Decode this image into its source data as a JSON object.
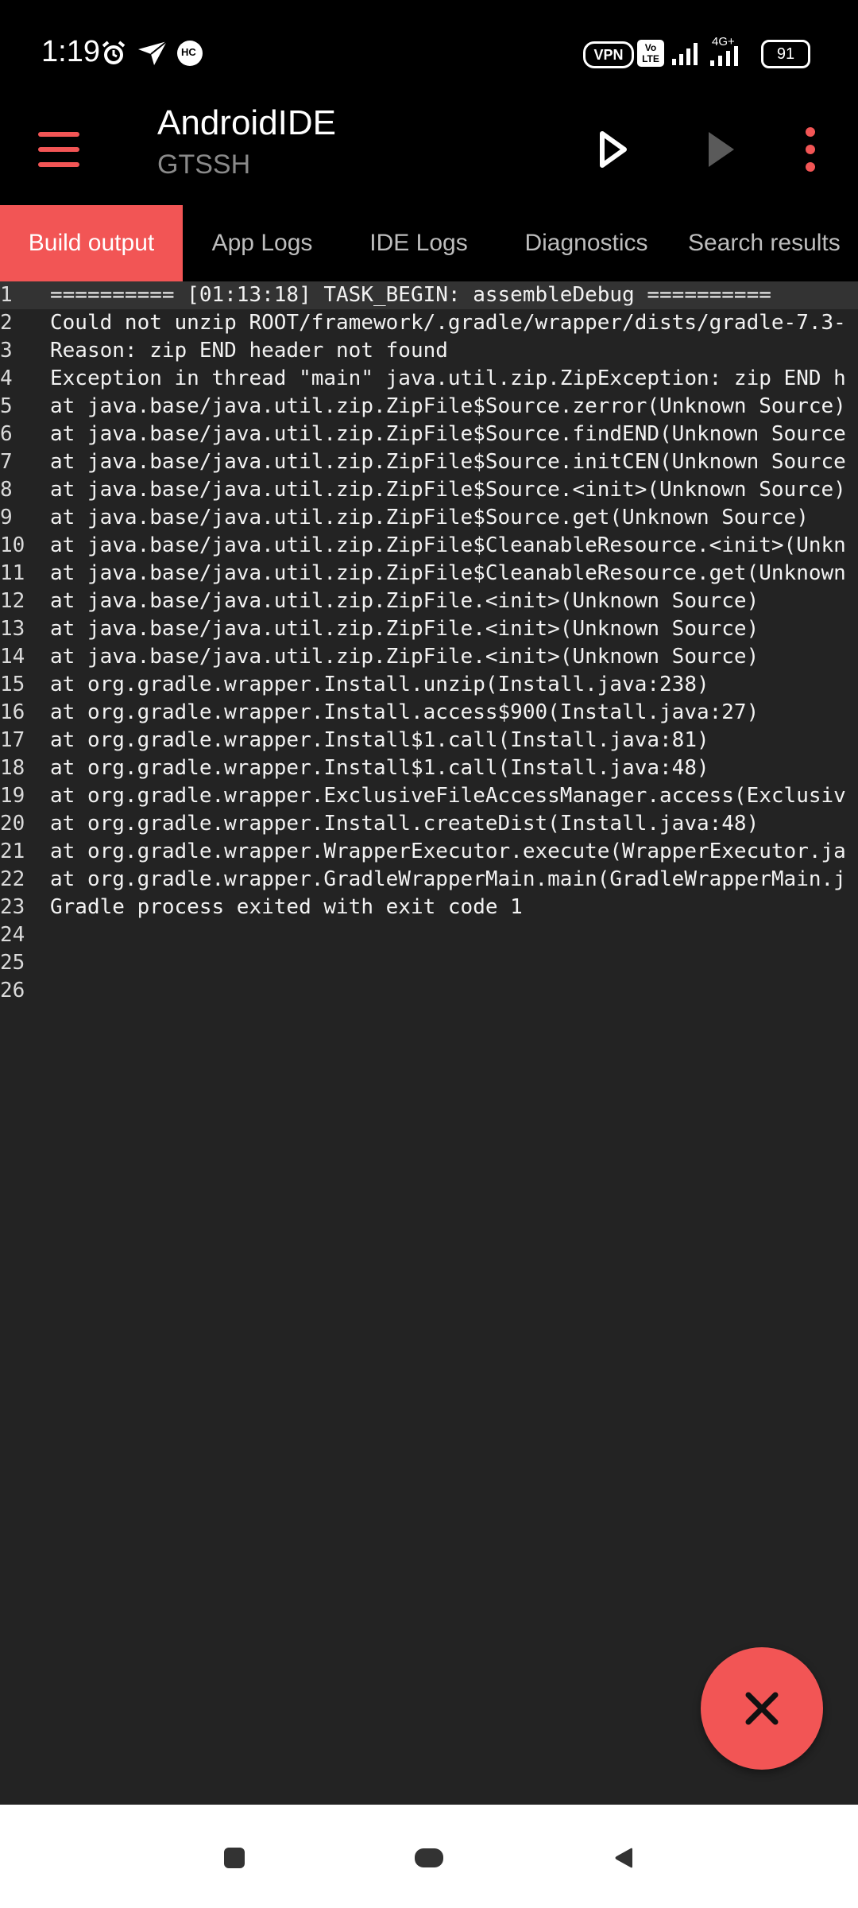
{
  "status_bar": {
    "time": "1:19",
    "vpn_label": "VPN",
    "volte_label": "Vo LTE",
    "network_label": "4G+",
    "battery_level": "91",
    "hc_label": "HC"
  },
  "toolbar": {
    "title": "AndroidIDE",
    "subtitle": "GTSSH",
    "accent_color": "#f25555"
  },
  "tabs": [
    {
      "label": "Build output",
      "active": true
    },
    {
      "label": "App Logs",
      "active": false
    },
    {
      "label": "IDE Logs",
      "active": false
    },
    {
      "label": "Diagnostics",
      "active": false
    },
    {
      "label": "Search results",
      "active": false
    }
  ],
  "log_lines": [
    {
      "n": "1",
      "text": "========== [01:13:18] TASK_BEGIN: assembleDebug =========="
    },
    {
      "n": "2",
      "text": "Could not unzip ROOT/framework/.gradle/wrapper/dists/gradle-7.3-"
    },
    {
      "n": "3",
      "text": "Reason: zip END header not found"
    },
    {
      "n": "4",
      "text": "Exception in thread \"main\" java.util.zip.ZipException: zip END h"
    },
    {
      "n": "5",
      "text": "at java.base/java.util.zip.ZipFile$Source.zerror(Unknown Source)"
    },
    {
      "n": "6",
      "text": "at java.base/java.util.zip.ZipFile$Source.findEND(Unknown Source"
    },
    {
      "n": "7",
      "text": "at java.base/java.util.zip.ZipFile$Source.initCEN(Unknown Source"
    },
    {
      "n": "8",
      "text": "at java.base/java.util.zip.ZipFile$Source.<init>(Unknown Source)"
    },
    {
      "n": "9",
      "text": "at java.base/java.util.zip.ZipFile$Source.get(Unknown Source)"
    },
    {
      "n": "10",
      "text": "at java.base/java.util.zip.ZipFile$CleanableResource.<init>(Unkn"
    },
    {
      "n": "11",
      "text": "at java.base/java.util.zip.ZipFile$CleanableResource.get(Unknown"
    },
    {
      "n": "12",
      "text": "at java.base/java.util.zip.ZipFile.<init>(Unknown Source)"
    },
    {
      "n": "13",
      "text": "at java.base/java.util.zip.ZipFile.<init>(Unknown Source)"
    },
    {
      "n": "14",
      "text": "at java.base/java.util.zip.ZipFile.<init>(Unknown Source)"
    },
    {
      "n": "15",
      "text": "at org.gradle.wrapper.Install.unzip(Install.java:238)"
    },
    {
      "n": "16",
      "text": "at org.gradle.wrapper.Install.access$900(Install.java:27)"
    },
    {
      "n": "17",
      "text": "at org.gradle.wrapper.Install$1.call(Install.java:81)"
    },
    {
      "n": "18",
      "text": "at org.gradle.wrapper.Install$1.call(Install.java:48)"
    },
    {
      "n": "19",
      "text": "at org.gradle.wrapper.ExclusiveFileAccessManager.access(Exclusiv"
    },
    {
      "n": "20",
      "text": "at org.gradle.wrapper.Install.createDist(Install.java:48)"
    },
    {
      "n": "21",
      "text": "at org.gradle.wrapper.WrapperExecutor.execute(WrapperExecutor.ja"
    },
    {
      "n": "22",
      "text": "at org.gradle.wrapper.GradleWrapperMain.main(GradleWrapperMain.j"
    },
    {
      "n": "23",
      "text": "Gradle process exited with exit code 1"
    },
    {
      "n": "24",
      "text": ""
    },
    {
      "n": "25",
      "text": ""
    },
    {
      "n": "26",
      "text": ""
    }
  ],
  "icons": {
    "menu": "hamburger-menu-icon",
    "run": "play-icon",
    "quick_run": "play-disabled-icon",
    "overflow": "more-vert-icon",
    "fab": "close-icon"
  }
}
